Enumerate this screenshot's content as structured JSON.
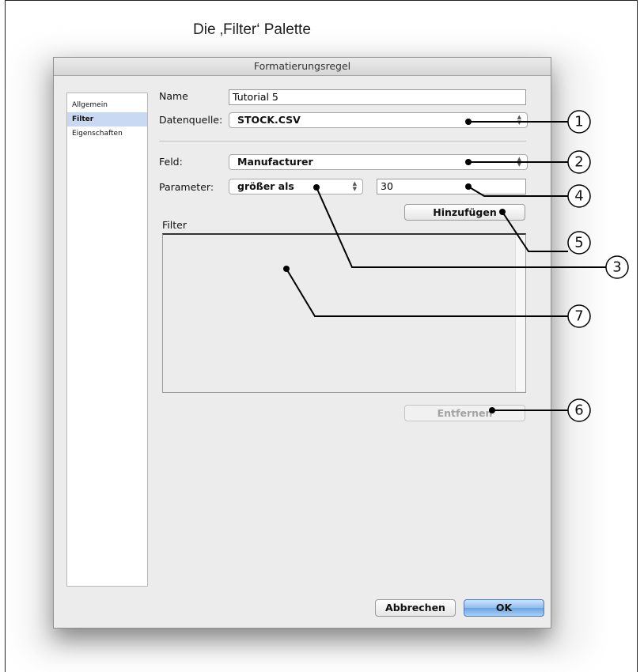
{
  "caption": "Die ‚Filter‘ Palette",
  "window": {
    "title": "Formatierungsregel"
  },
  "sidebar": {
    "items": [
      {
        "label": "Allgemein"
      },
      {
        "label": "Filter"
      },
      {
        "label": "Eigenschaften"
      }
    ]
  },
  "form": {
    "name_label": "Name",
    "name_value": "Tutorial 5",
    "source_label": "Datenquelle:",
    "source_value": "STOCK.CSV",
    "field_label": "Feld:",
    "field_value": "Manufacturer",
    "parameter_label": "Parameter:",
    "parameter_value": "größer als",
    "parameter_number": "30",
    "add_button": "Hinzufügen",
    "filter_label": "Filter",
    "remove_button": "Entfernen"
  },
  "footer": {
    "cancel_button": "Abbrechen",
    "ok_button": "OK"
  },
  "callouts": [
    "1",
    "2",
    "3",
    "4",
    "5",
    "6",
    "7"
  ]
}
